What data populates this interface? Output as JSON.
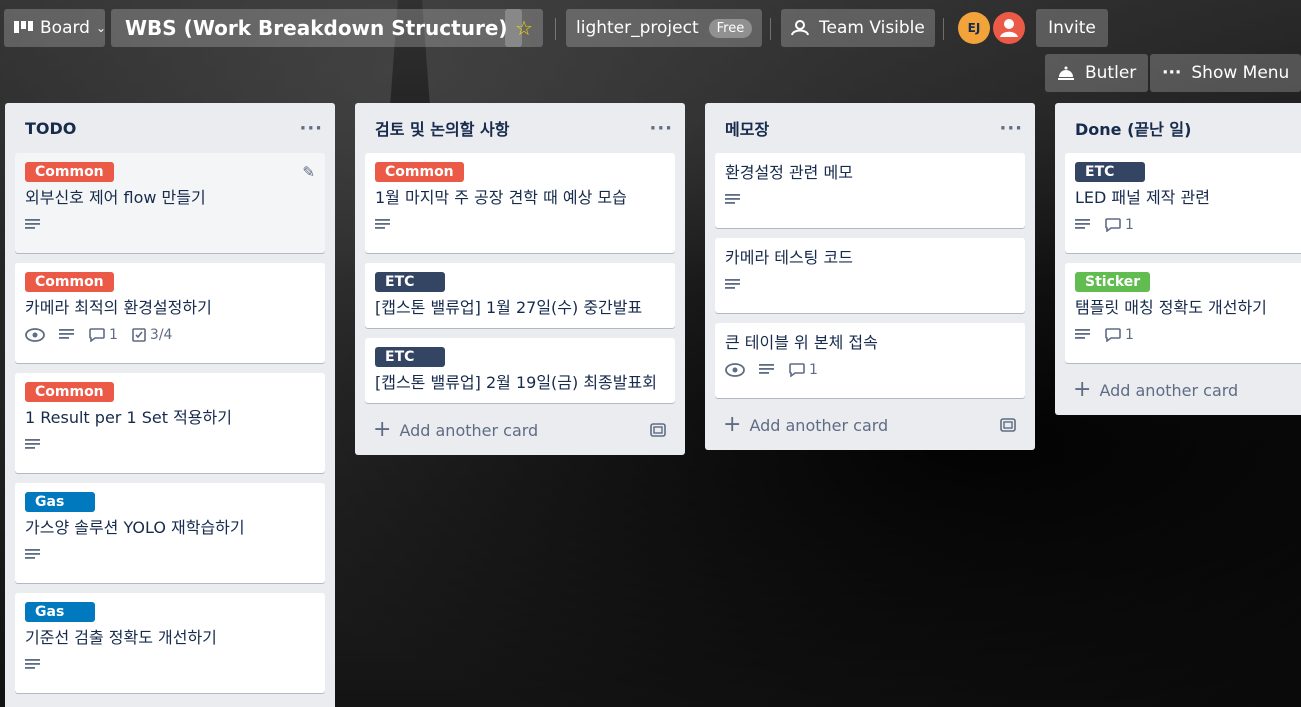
{
  "header": {
    "board_switch_label": "Board",
    "board_title": "WBS (Work Breakdown Structure)",
    "workspace": "lighter_project",
    "plan_badge": "Free",
    "visibility": "Team Visible",
    "avatar_initials": "EJ",
    "invite_label": "Invite",
    "butler_label": "Butler",
    "show_menu_label": "Show Menu"
  },
  "colors": {
    "common": "#eb5a46",
    "etc": "#344563",
    "gas": "#0079bf",
    "sticker": "#61bd4f",
    "avatar_orange": "#f2a43a",
    "avatar_red": "#eb5a46"
  },
  "lists": [
    {
      "title": "TODO",
      "cards": [
        {
          "label": "Common",
          "title": "외부신호 제어 flow 만들기"
        },
        {
          "label": "Common",
          "title": "카메라 최적의 환경설정하기",
          "comments": "1",
          "checklist": "3/4"
        },
        {
          "label": "Common",
          "title": "1 Result per 1 Set 적용하기"
        },
        {
          "label": "Gas",
          "title": "가스양 솔루션 YOLO 재학습하기"
        },
        {
          "label": "Gas",
          "title": "기준선 검출 정확도 개선하기"
        }
      ]
    },
    {
      "title": "검토 및 논의할 사항",
      "cards": [
        {
          "label": "Common",
          "title": "1월 마지막 주 공장 견학 때 예상 모습"
        },
        {
          "label": "ETC",
          "title": "[캡스톤 밸류업] 1월 27일(수) 중간발표"
        },
        {
          "label": "ETC",
          "title": "[캡스톤 밸류업] 2월 19일(금) 최종발표회"
        }
      ],
      "add_label": "Add another card"
    },
    {
      "title": "메모장",
      "cards": [
        {
          "title": "환경설정 관련 메모"
        },
        {
          "title": "카메라 테스팅 코드"
        },
        {
          "title": "큰 테이블 위 본체 접속",
          "comments": "1"
        }
      ],
      "add_label": "Add another card"
    },
    {
      "title": "Done (끝난 일)",
      "cards": [
        {
          "label": "ETC",
          "title": "LED 패널 제작 관련",
          "comments": "1"
        },
        {
          "label": "Sticker",
          "title": "탬플릿 매칭 정확도 개선하기",
          "comments": "1"
        }
      ],
      "add_label": "Add another card"
    }
  ],
  "icons": [
    "board-icon",
    "chevron-down-icon",
    "star-icon",
    "team-icon",
    "butler-icon",
    "ellipsis-icon",
    "edit-icon",
    "eye-icon",
    "description-icon",
    "comment-icon",
    "checklist-icon",
    "plus-icon",
    "template-icon"
  ]
}
